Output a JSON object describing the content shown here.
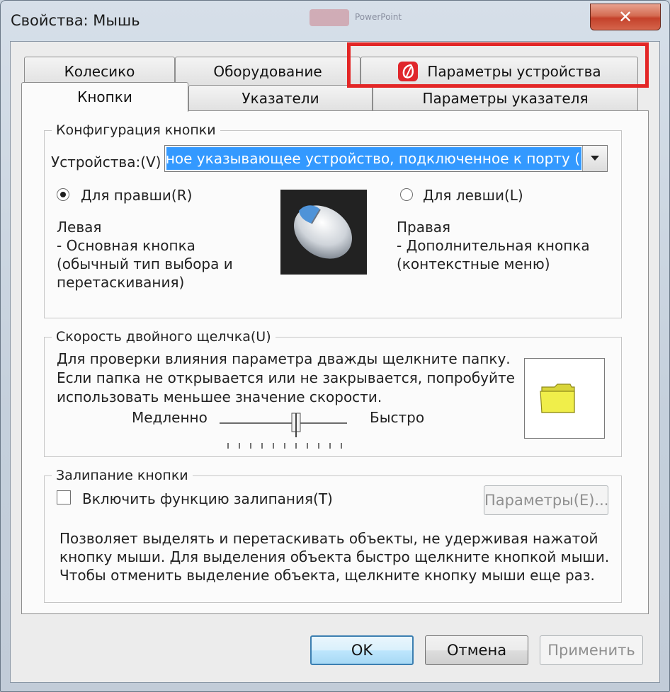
{
  "window": {
    "title": "Свойства: Мышь",
    "close_glyph": "✕",
    "bg_title_fragment": "PowerPoint"
  },
  "tabs_top": [
    {
      "label": "Колесико"
    },
    {
      "label": "Оборудование"
    },
    {
      "label": "Параметры устройства",
      "icon": "device-settings-icon"
    }
  ],
  "tabs_bottom": [
    {
      "label": "Кнопки",
      "active": true
    },
    {
      "label": "Указатели"
    },
    {
      "label": "Параметры указателя"
    }
  ],
  "button_config": {
    "legend": "Конфигурация кнопки",
    "devices_label": "Устройства:(V)",
    "devices_value": "дартное указывающее устройство, подключенное к порту (",
    "right_handed_label": "Для правши(R)",
    "left_handed_label": "Для левши(L)",
    "right_handed_selected": true,
    "left_title": "Левая",
    "left_line1": " - Основная кнопка",
    "left_line2": "(обычный тип выбора и",
    "left_line3": "перетаскивания)",
    "right_title": "Правая",
    "right_line1": " - Дополнительная кнопка",
    "right_line2": "(контекстные меню)"
  },
  "double_click": {
    "legend": "Скорость двойного щелчка(U)",
    "line1": "Для проверки влияния параметра дважды щелкните папку.",
    "line2": "Если папка не открывается или не закрывается, попробуйте",
    "line3": "использовать меньшее значение скорости.",
    "slow_label": "Медленно",
    "fast_label": "Быстро",
    "speed_fraction": 0.6
  },
  "click_lock": {
    "legend": "Залипание кнопки",
    "checkbox_label": "Включить функцию залипания(T)",
    "checked": false,
    "settings_button": "Параметры(E)...",
    "desc1": "Позволяет выделять и перетаскивать объекты, не удерживая нажатой",
    "desc2": "кнопку мыши. Для выделения объекта быстро щелкните кнопкой мыши.",
    "desc3": "Чтобы отменить выделение объекта, щелкните кнопку мыши еще раз."
  },
  "buttons": {
    "ok": "OK",
    "cancel": "Отмена",
    "apply": "Применить"
  },
  "colors": {
    "highlight": "#e32626",
    "selection": "#3399ff",
    "folder": "#f0ee4a"
  }
}
